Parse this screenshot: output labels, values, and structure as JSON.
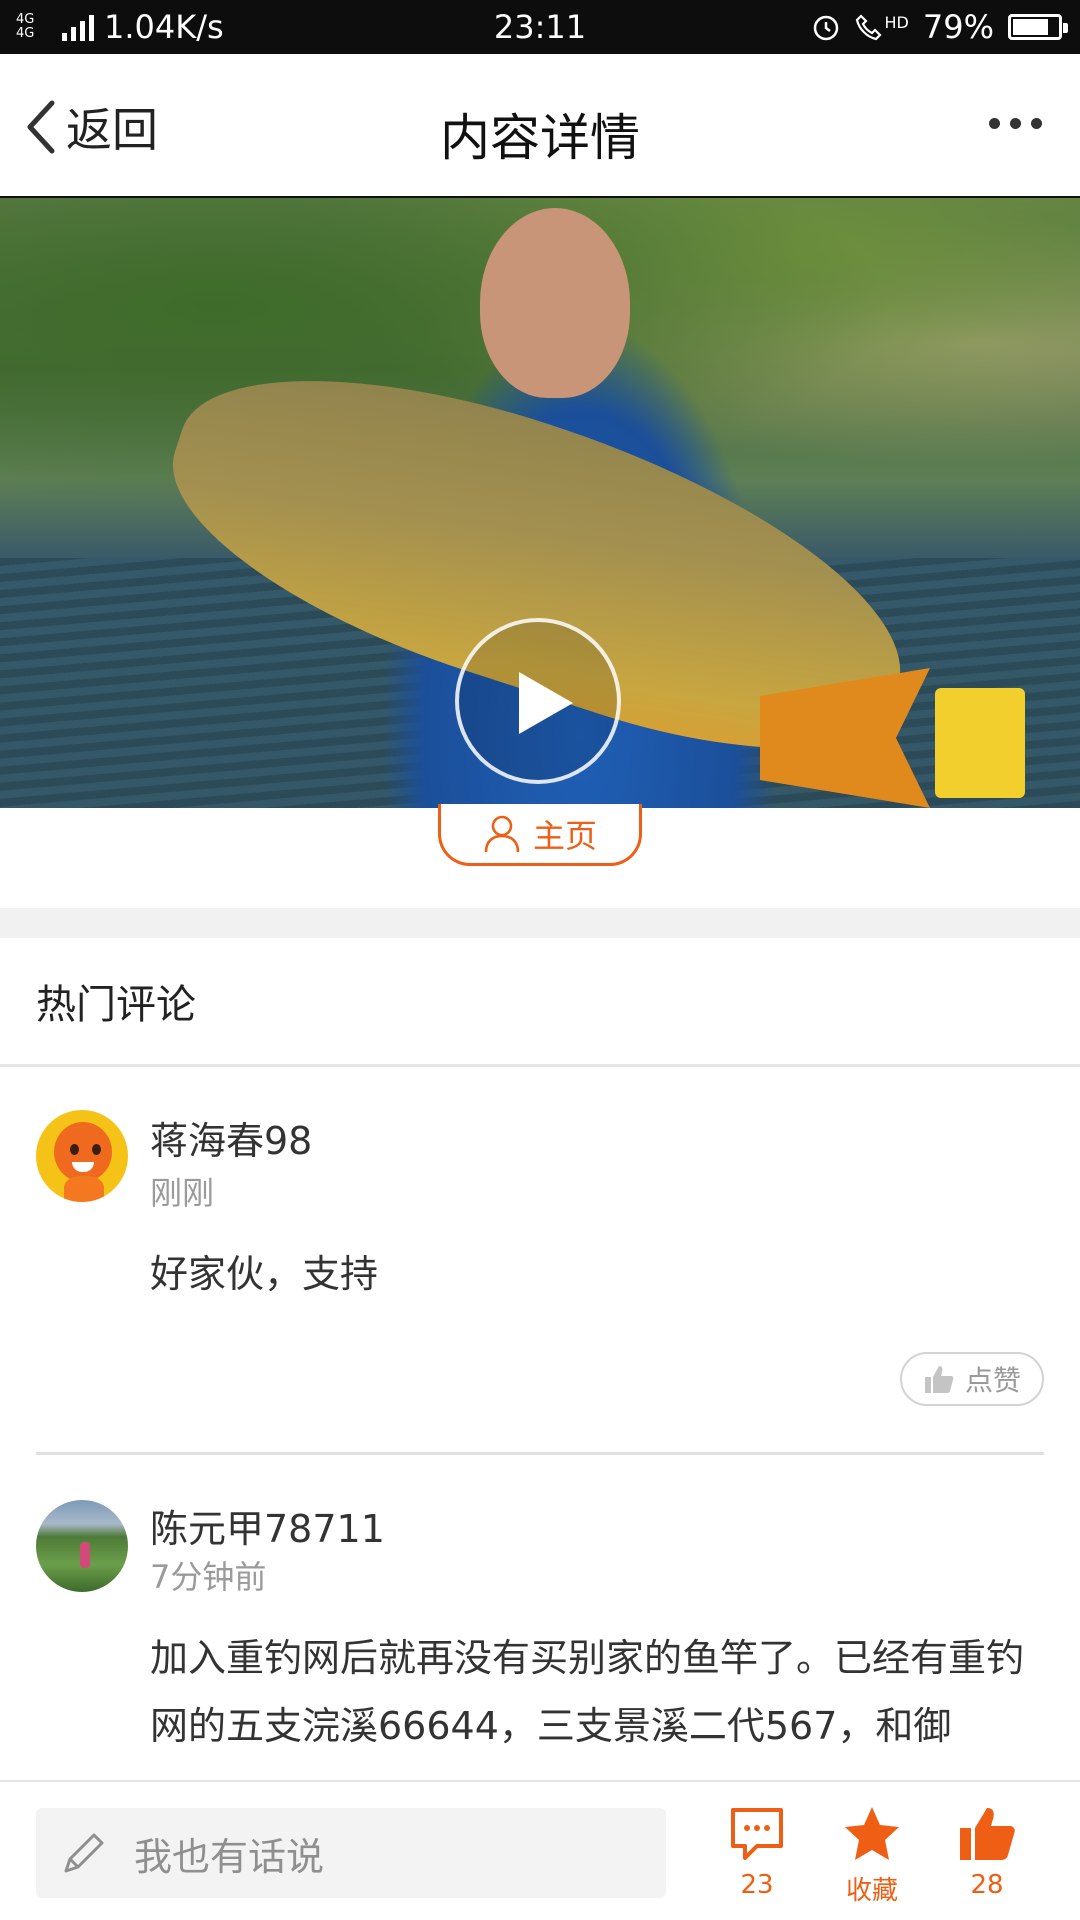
{
  "status_bar": {
    "network": "4G 4G",
    "speed": "1.04K/s",
    "time": "23:11",
    "hd": "HD",
    "battery": "79%",
    "battery_level": 0.79
  },
  "nav": {
    "back_label": "返回",
    "title": "内容详情"
  },
  "video": {
    "play_icon": "play-icon"
  },
  "profile_button": {
    "label": "主页"
  },
  "hot_comments": {
    "title": "热门评论",
    "items": [
      {
        "name": "蒋海春98",
        "time": "刚刚",
        "text": "好家伙，支持",
        "like_label": "点赞"
      },
      {
        "name": "陈元甲78711",
        "time": "7分钟前",
        "text": "加入重钓网后就再没有买别家的鱼竿了。已经有重钓网的五支浣溪66644，三支景溪二代567，和御"
      }
    ]
  },
  "bottom_bar": {
    "placeholder": "我也有话说",
    "comment_count": "23",
    "favorite_label": "收藏",
    "like_count": "28"
  },
  "colors": {
    "accent": "#ee5f15",
    "status_bar": "#0d0d0d"
  }
}
